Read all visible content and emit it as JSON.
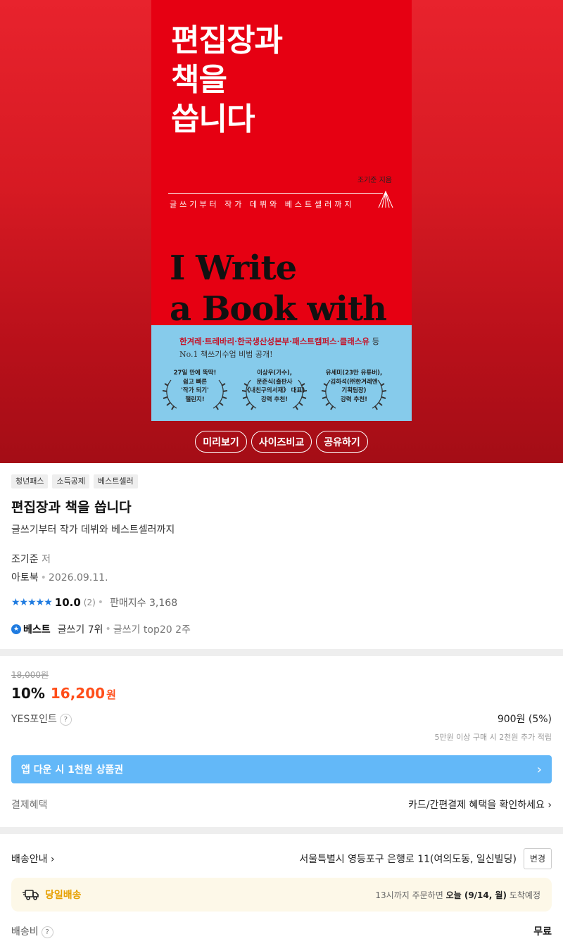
{
  "cover": {
    "title": "편집장과\n책을\n씁니다",
    "author": "조기준 지음",
    "subtitle": "글쓰기부터 작가 데뷔와 베스트셀러까지",
    "english_title": "I Write\na Book with",
    "band_line1": "한겨레·트레바리·한국생산성본부·패스트캠퍼스·클래스유",
    "band_line1_suffix": " 등",
    "band_line2": "No.1 책쓰기수업 비법 공개!",
    "laurels": [
      "27일 만에 뚝딱!\n쉽고 빠른\n'작가 되기'\n챌린지!",
      "이상우(가수),\n문준식(출판사\n《내친구의서재》 대표)\n강력 추천!",
      "유세미(23만 유튜버),\n김하석(㈜한겨레엔\n기획팀장)\n강력 추천!"
    ]
  },
  "hero_buttons": [
    "미리보기",
    "사이즈비교",
    "공유하기"
  ],
  "tags": [
    "청년패스",
    "소득공제",
    "베스트셀러"
  ],
  "book": {
    "title": "편집장과 책을 씁니다",
    "subtitle": "글쓰기부터 작가 데뷔와 베스트셀러까지",
    "author": "조기준",
    "author_role": "저",
    "publisher": "아토북",
    "date": "2026.09.11.",
    "stars": "★★★★★",
    "rating": "10.0",
    "review_count": "(2)",
    "sales_index": "판매지수 3,168",
    "best_label": "베스트",
    "best_rank": "글쓰기 7위",
    "best_extra": "글쓰기 top20 2주"
  },
  "price": {
    "original": "18,000원",
    "discount": "10%",
    "sale": "16,200",
    "won": "원",
    "points_label": "YES포인트",
    "points_value": "900원 (5%)",
    "points_note": "5만원 이상 구매 시 2천원 추가 적립",
    "coupon": "앱 다운 시 1천원 상품권",
    "pay_label": "결제혜택",
    "pay_link": "카드/간편결제 혜택을 확인하세요"
  },
  "shipping": {
    "label": "배송안내",
    "address": "서울특별시 영등포구 은행로 11(여의도동, 일신빌딩)",
    "change": "변경",
    "sameday_label": "당일배송",
    "sameday_pre": "13시까지 주문하면 ",
    "sameday_bold": "오늘 (9/14, 월)",
    "sameday_post": " 도착예정",
    "fee_label": "배송비",
    "fee_value": "무료"
  },
  "colors": {
    "accent_blue": "#1f7be0",
    "sale_orange": "#ff4e1a",
    "coupon_blue": "#63b8f8",
    "cover_red": "#e60012",
    "band_blue": "#86cbeb"
  }
}
